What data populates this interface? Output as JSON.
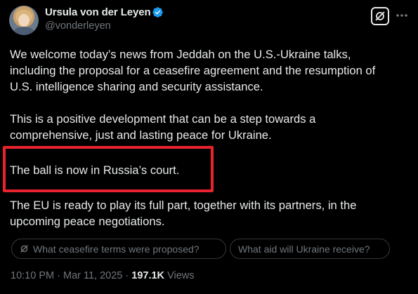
{
  "author": {
    "name": "Ursula von der Leyen",
    "handle": "@vonderleyen",
    "avatar_icon": "profile-photo",
    "verified_icon": "verified-badge-icon",
    "verified_color": "#1d9bf0"
  },
  "header_actions": {
    "grok_icon": "grok-icon",
    "more_icon": "more-horizontal-icon"
  },
  "tweet": {
    "lines": [
      "We welcome today’s news from Jeddah on the U.S.-Ukraine talks,",
      "including the proposal for a ceasefire agreement and the resumption of",
      "U.S. intelligence sharing and security assistance.",
      "This is a positive development that can be a step towards a",
      "comprehensive, just and lasting peace for Ukraine.",
      "The ball is now in Russia’s court.",
      "The EU is ready to play its full part, together with its partners, in the",
      "upcoming peace negotiations."
    ],
    "highlight_color": "#e8232d"
  },
  "suggestions": [
    {
      "label": "What ceasefire terms were proposed?",
      "icon": "grok-icon"
    },
    {
      "label": "What aid will Ukraine receive?"
    }
  ],
  "meta": {
    "time": "10:10 PM",
    "separator": "·",
    "date": "Mar 11, 2025",
    "views_count": "197.1K",
    "views_label": "Views"
  }
}
